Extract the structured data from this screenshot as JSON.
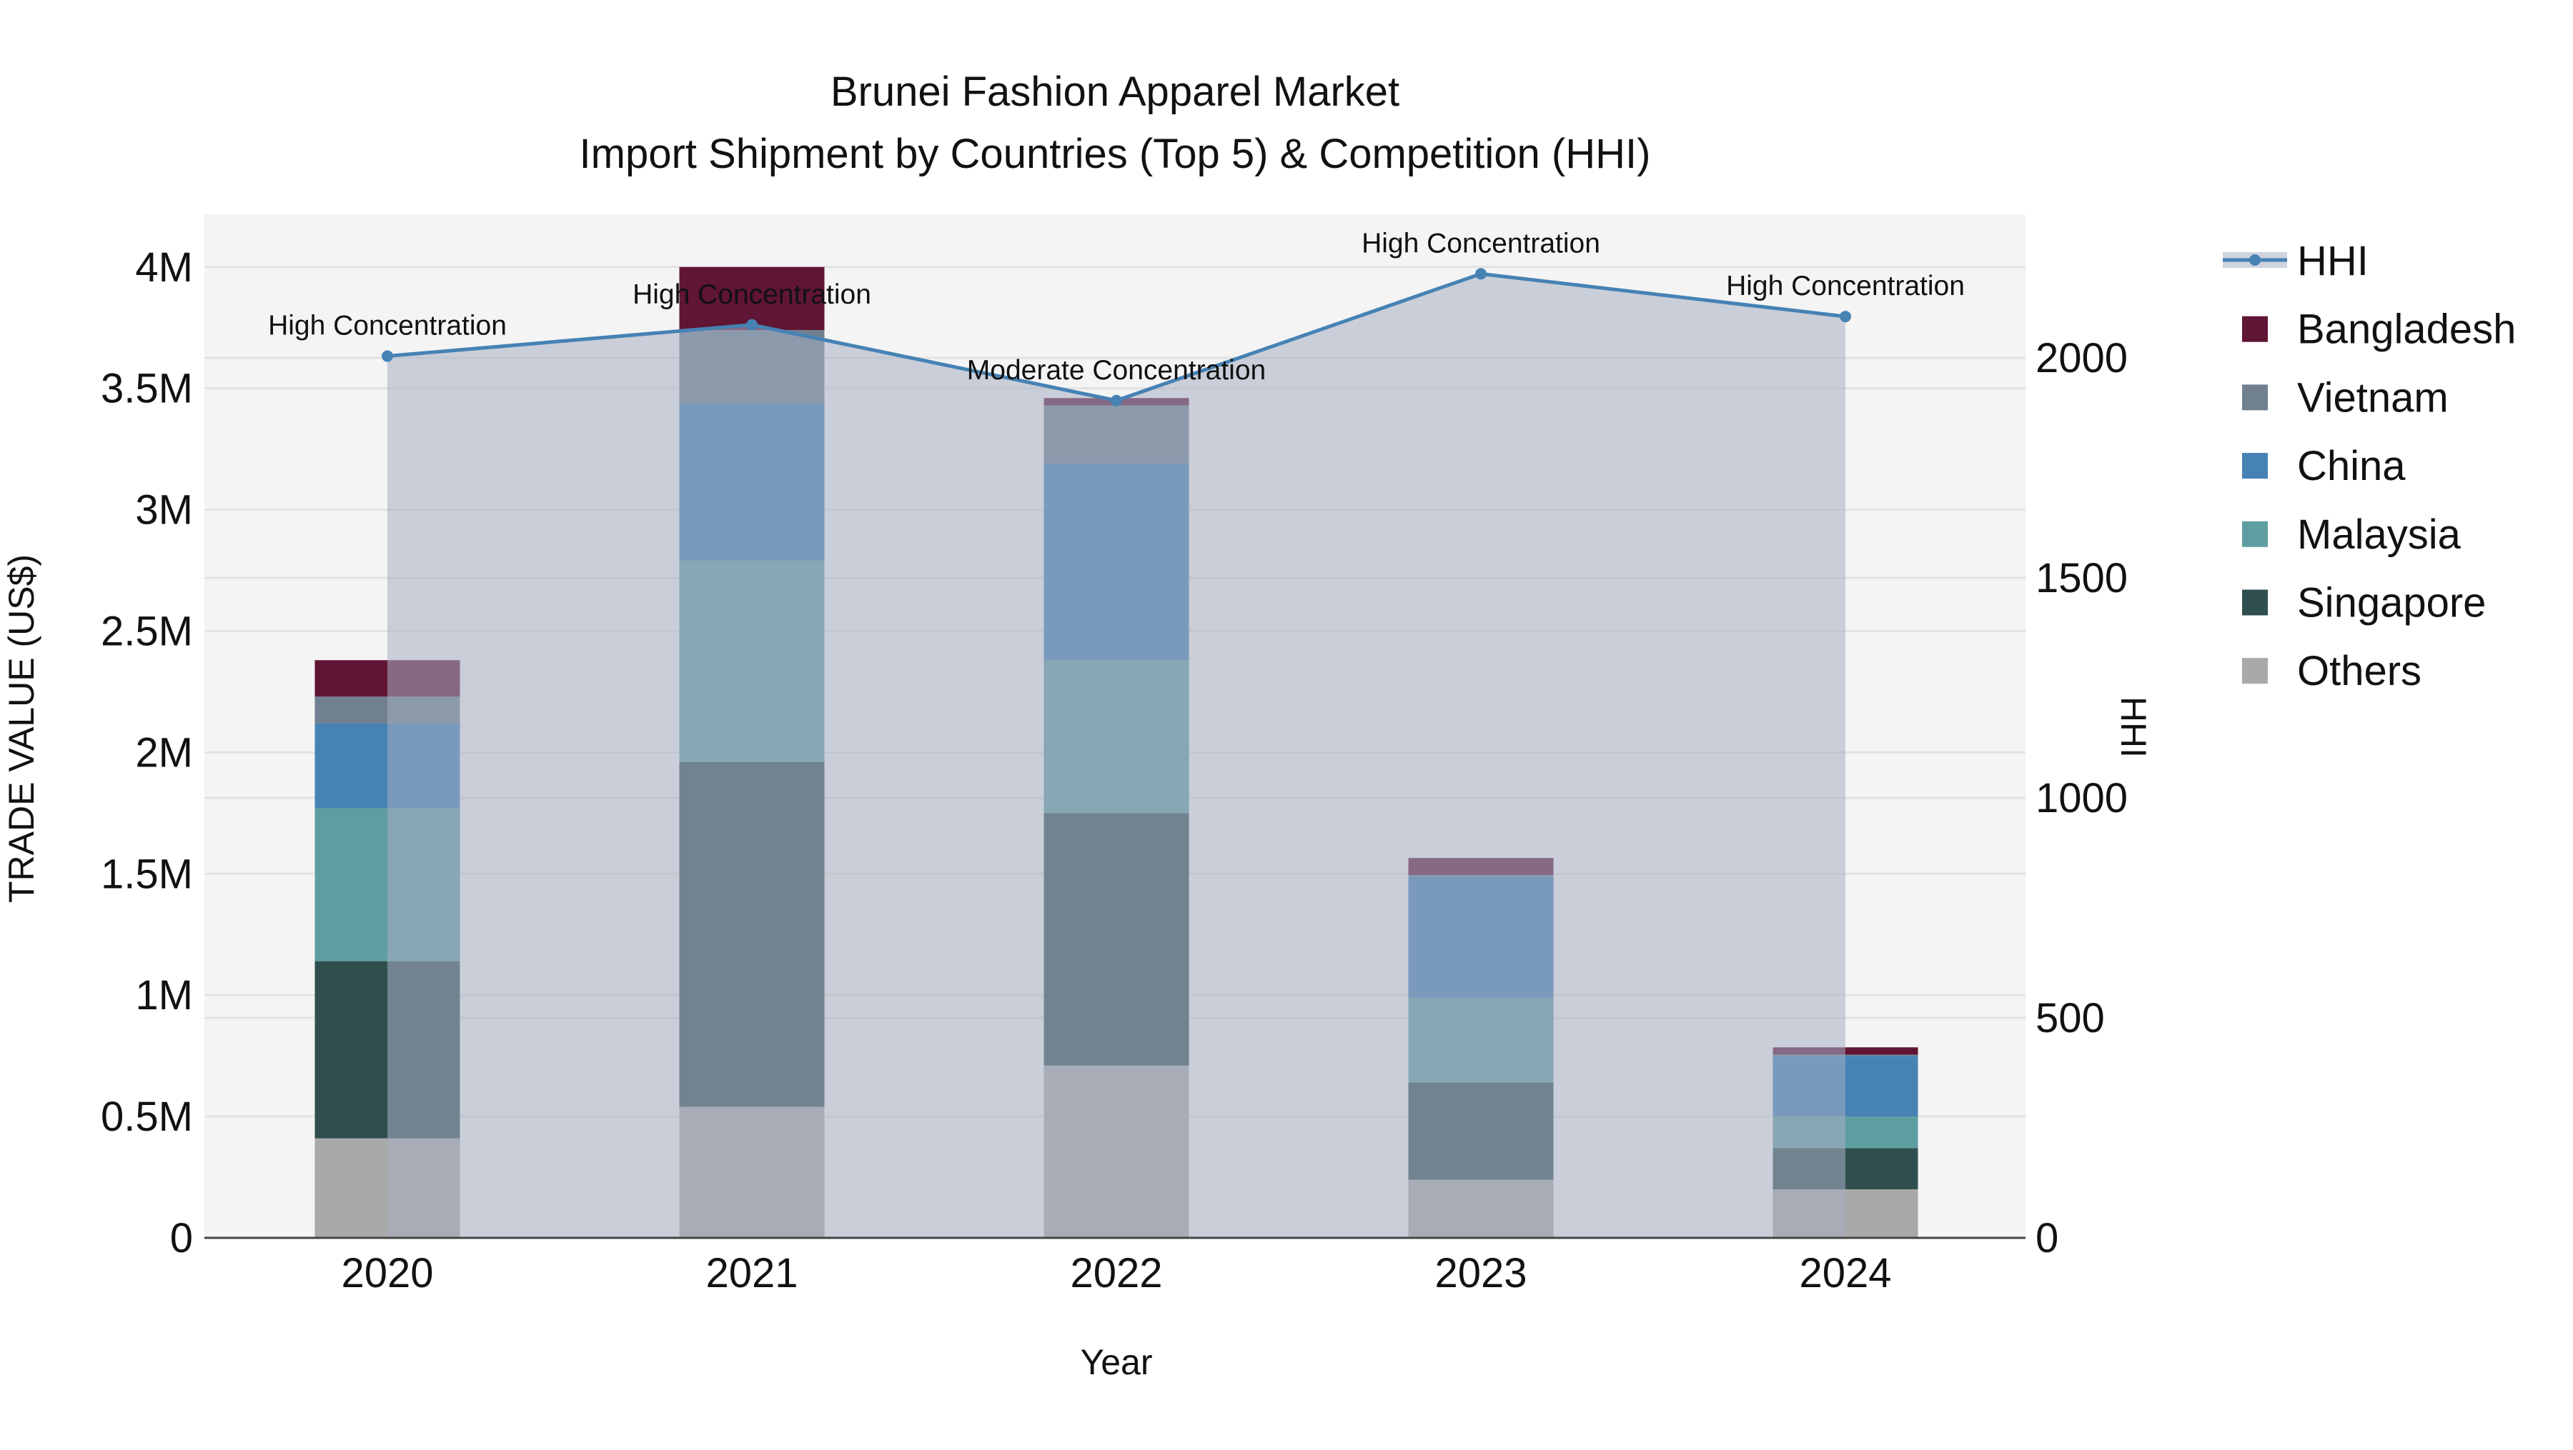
{
  "chart_data": {
    "type": "bar",
    "title_line1": "Brunei Fashion Apparel Market",
    "title_line2": "Import Shipment by Countries (Top 5) & Competition (HHI)",
    "xlabel": "Year",
    "ylabel": "TRADE VALUE (US$)",
    "y2label": "HHI",
    "categories": [
      "2020",
      "2021",
      "2022",
      "2023",
      "2024"
    ],
    "ylim": [
      0,
      4200000
    ],
    "yticks": [
      0,
      500000,
      1000000,
      1500000,
      2000000,
      2500000,
      3000000,
      3500000,
      4000000
    ],
    "ytick_labels": [
      "0",
      "0.5M",
      "1M",
      "1.5M",
      "2M",
      "2.5M",
      "3M",
      "3.5M",
      "4M"
    ],
    "y2lim": [
      0,
      2300
    ],
    "y2ticks": [
      0,
      500,
      1000,
      1500,
      2000
    ],
    "y2tick_labels": [
      "0",
      "500",
      "1000",
      "1500",
      "2000"
    ],
    "grid": true,
    "legend_position": "right",
    "series": [
      {
        "name": "Others",
        "color": "#a9a9a9",
        "values": [
          410000,
          540000,
          710000,
          240000,
          200000
        ]
      },
      {
        "name": "Singapore",
        "color": "#2f4f4f",
        "values": [
          730000,
          1420000,
          1040000,
          400000,
          170000
        ]
      },
      {
        "name": "Malaysia",
        "color": "#5f9ea0",
        "values": [
          630000,
          830000,
          630000,
          350000,
          130000
        ]
      },
      {
        "name": "China",
        "color": "#4682b4",
        "values": [
          350000,
          650000,
          810000,
          500000,
          250000
        ]
      },
      {
        "name": "Vietnam",
        "color": "#708090",
        "values": [
          110000,
          300000,
          240000,
          5000,
          5000
        ]
      },
      {
        "name": "Bangladesh",
        "color": "#601535",
        "values": [
          150000,
          260000,
          30000,
          70000,
          30000
        ]
      }
    ],
    "hhi": {
      "name": "HHI",
      "color": "#4682b4",
      "values": [
        2004,
        2075,
        1903,
        2191,
        2094
      ],
      "annotations": [
        "High Concentration",
        "High Concentration",
        "Moderate Concentration",
        "High Concentration",
        "High Concentration"
      ]
    },
    "legend_order": [
      "HHI",
      "Bangladesh",
      "Vietnam",
      "China",
      "Malaysia",
      "Singapore",
      "Others"
    ]
  }
}
